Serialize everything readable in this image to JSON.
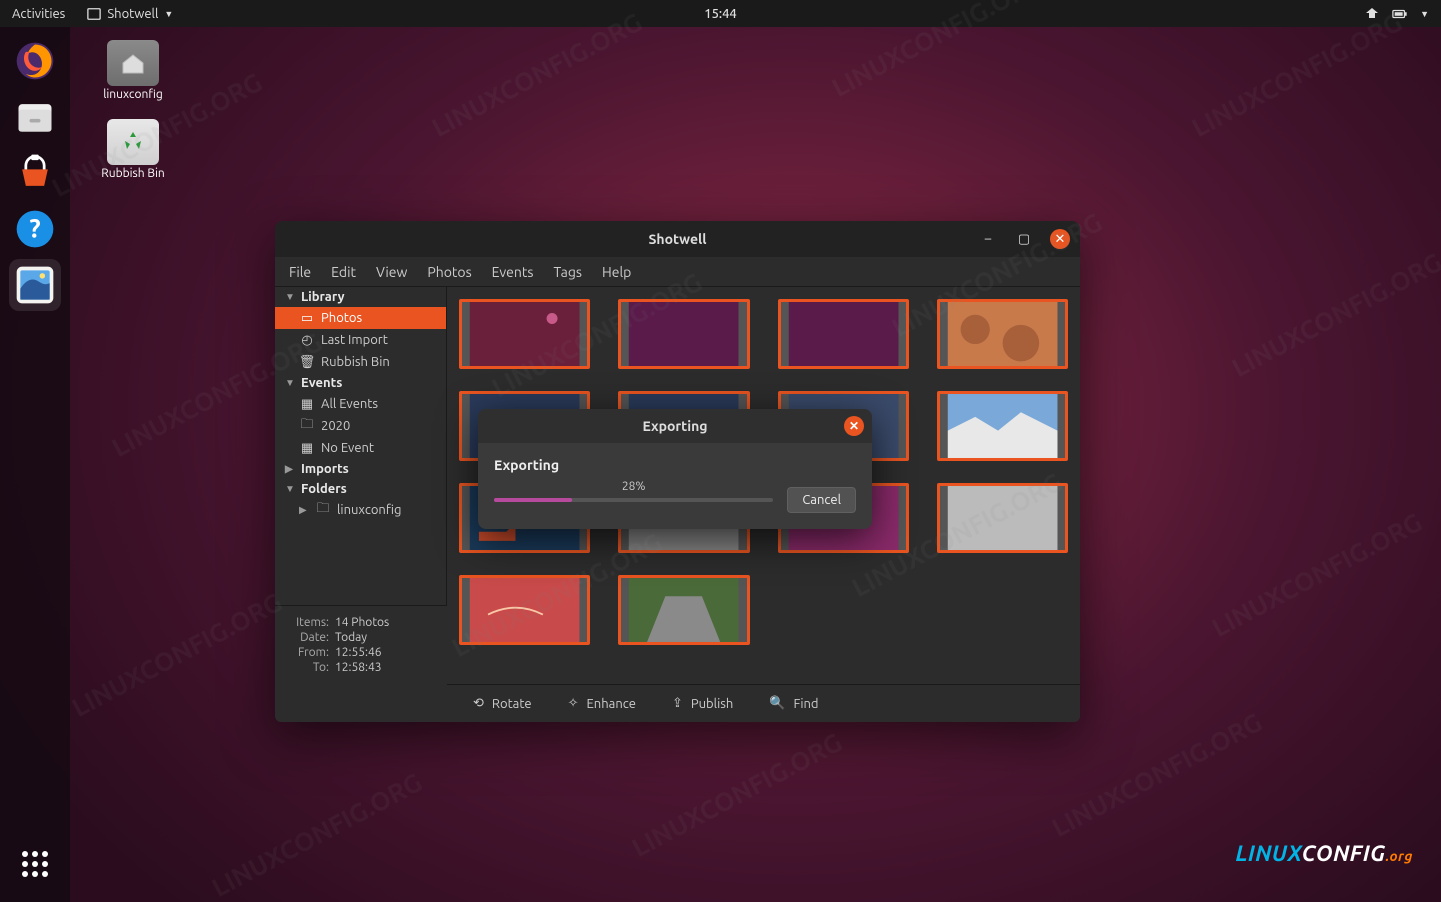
{
  "topbar": {
    "activities": "Activities",
    "app": "Shotwell",
    "clock": "15:44"
  },
  "desktop_icons": {
    "home": "linuxconfig",
    "trash": "Rubbish Bin"
  },
  "window": {
    "title": "Shotwell",
    "menu": [
      "File",
      "Edit",
      "View",
      "Photos",
      "Events",
      "Tags",
      "Help"
    ],
    "sidebar": {
      "library": "Library",
      "photos": "Photos",
      "last_import": "Last Import",
      "rubbish": "Rubbish Bin",
      "events": "Events",
      "all_events": "All Events",
      "y2020": "2020",
      "no_event": "No Event",
      "imports": "Imports",
      "folders": "Folders",
      "folder1": "linuxconfig"
    },
    "meta": {
      "items_k": "Items:",
      "items_v": "14 Photos",
      "date_k": "Date:",
      "date_v": "Today",
      "from_k": "From:",
      "from_v": "12:55:46",
      "to_k": "To:",
      "to_v": "12:58:43"
    },
    "toolbar": {
      "rotate": "Rotate",
      "enhance": "Enhance",
      "publish": "Publish",
      "find": "Find"
    }
  },
  "dialog": {
    "title": "Exporting",
    "label": "Exporting",
    "pct_text": "28%",
    "pct_value": 28,
    "cancel": "Cancel"
  },
  "branding": {
    "prefix": "LINUX",
    "mid": "CONFIG",
    "suffix": ".org",
    "wm": "LINUXCONFIG.ORG"
  }
}
